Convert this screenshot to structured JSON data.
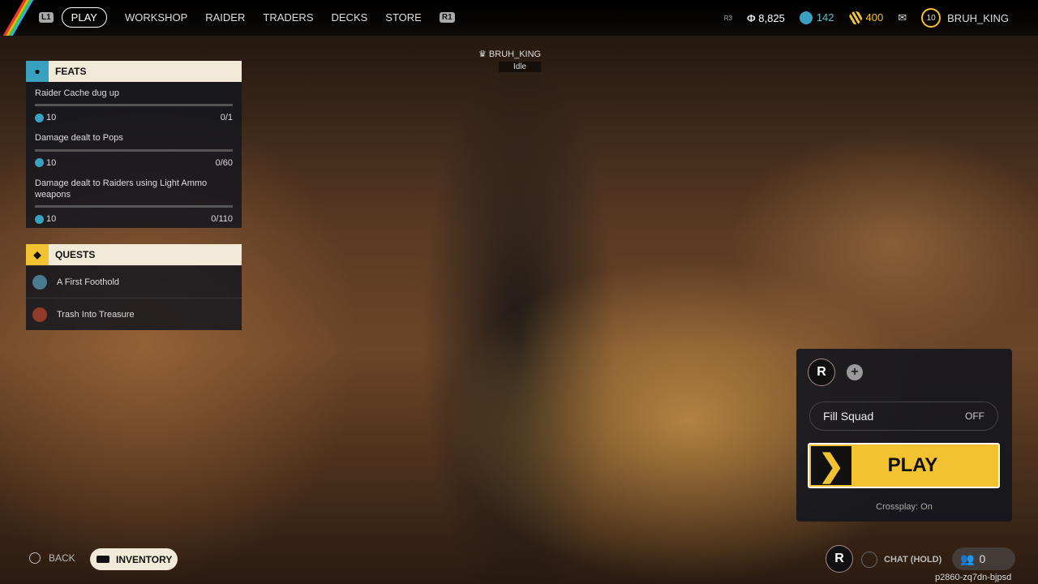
{
  "nav": {
    "left_bumper": "L1",
    "right_bumper": "R1",
    "tabs": [
      "PLAY",
      "WORKSHOP",
      "RAIDER",
      "TRADERS",
      "DECKS",
      "STORE"
    ]
  },
  "status": {
    "r3": "R3",
    "coins": "8,825",
    "blue_currency": "142",
    "gold_currency": "400",
    "level": "10",
    "username": "BRUH_KING"
  },
  "player_tag": {
    "name": "BRUH_KING",
    "state": "Idle"
  },
  "feats": {
    "title": "FEATS",
    "items": [
      {
        "name": "Raider Cache dug up",
        "reward": "10",
        "progress": "0/1",
        "fraction": 0
      },
      {
        "name": "Damage dealt to Pops",
        "reward": "10",
        "progress": "0/60",
        "fraction": 0
      },
      {
        "name": "Damage dealt to Raiders using Light Ammo weapons",
        "reward": "10",
        "progress": "0/110",
        "fraction": 0
      }
    ]
  },
  "quests": {
    "title": "QUESTS",
    "items": [
      "A First Foothold",
      "Trash Into Treasure"
    ]
  },
  "squad": {
    "fill_label": "Fill Squad",
    "fill_value": "OFF",
    "play_label": "PLAY",
    "crossplay": "Crossplay: On"
  },
  "footer": {
    "back": "BACK",
    "inventory": "INVENTORY",
    "chat": "CHAT (HOLD)",
    "party_count": "0",
    "session_id": "p2860-zq7dn-bjpsd"
  }
}
